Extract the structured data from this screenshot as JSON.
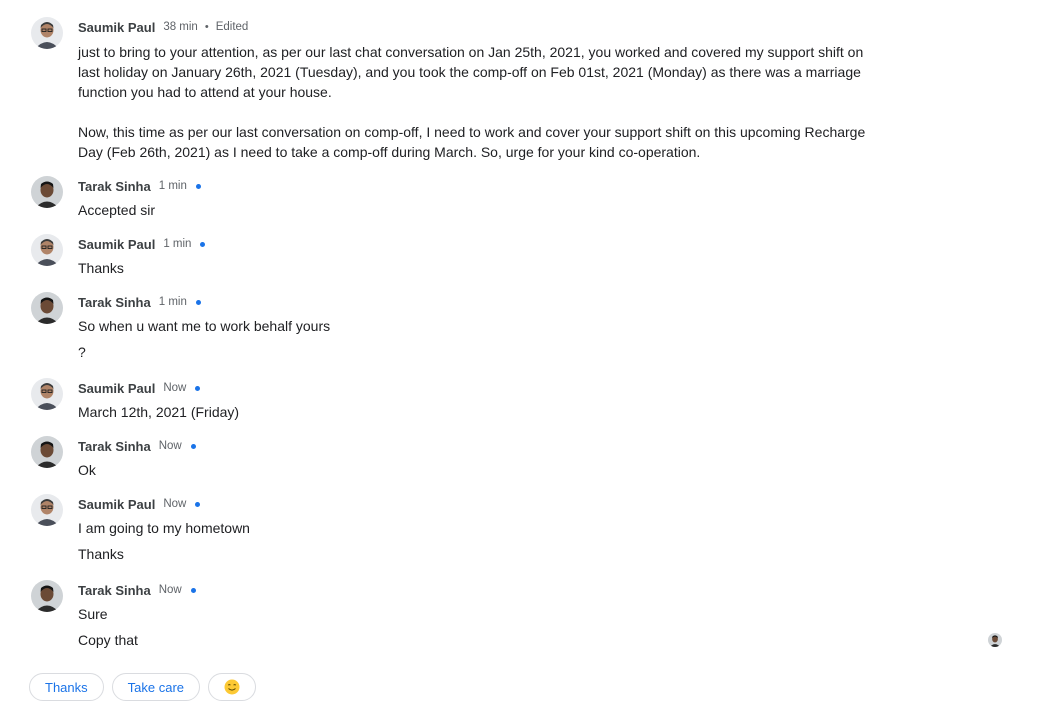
{
  "messages": [
    {
      "sender": "Saumik Paul",
      "time": "38 min",
      "dot": "•",
      "edited": "Edited",
      "lines": [
        "just to bring to your attention, as per our last chat conversation on Jan 25th, 2021, you worked and covered my support shift on",
        "last holiday on January 26th, 2021 (Tuesday), and you took the comp-off on Feb 01st, 2021 (Monday) as there was a marriage",
        "function you had to attend at your house.",
        "",
        "Now, this time as per our last conversation on comp-off, I need to work and cover your support shift on this upcoming Recharge",
        "Day (Feb 26th, 2021) as I need to take a comp-off during March. So, urge for your kind co-operation."
      ]
    },
    {
      "sender": "Tarak Sinha",
      "time": "1 min",
      "lines": [
        "Accepted sir"
      ]
    },
    {
      "sender": "Saumik Paul",
      "time": "1 min",
      "lines": [
        "Thanks"
      ]
    },
    {
      "sender": "Tarak Sinha",
      "time": "1 min",
      "lines": [
        "So when u want me to work behalf yours",
        "?"
      ]
    },
    {
      "sender": "Saumik Paul",
      "time": "Now",
      "lines": [
        "March 12th, 2021 (Friday)"
      ]
    },
    {
      "sender": "Tarak Sinha",
      "time": "Now",
      "lines": [
        "Ok"
      ]
    },
    {
      "sender": "Saumik Paul",
      "time": "Now",
      "lines": [
        "I am going to my hometown",
        "Thanks"
      ]
    },
    {
      "sender": "Tarak Sinha",
      "time": "Now",
      "lines": [
        "Sure",
        "Copy that"
      ]
    }
  ],
  "smart_replies": {
    "thanks": "Thanks",
    "take_care": "Take care",
    "emoji": "smile-emoji"
  },
  "colors": {
    "accent": "#1a73e8",
    "unread": "#1a73e8"
  }
}
